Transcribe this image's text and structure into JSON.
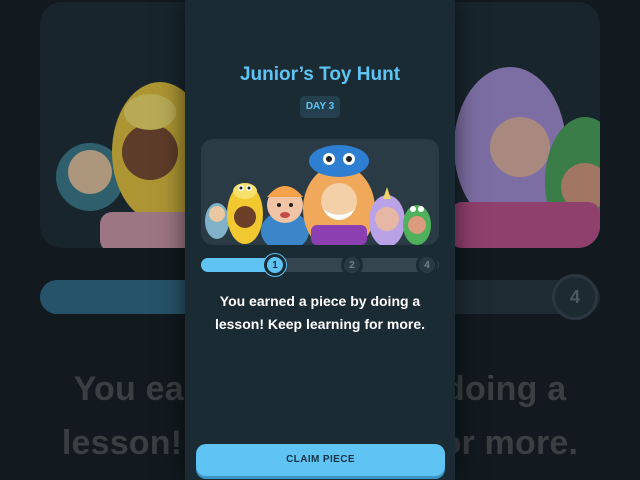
{
  "modal": {
    "title": "Junior’s Toy Hunt",
    "day_badge": "DAY 3",
    "message_line1": "You earned a piece by doing a",
    "message_line2": "lesson! Keep learning for more.",
    "claim_button": "CLAIM PIECE"
  },
  "progress": {
    "fraction": 0.3,
    "steps": [
      {
        "label": "1",
        "state": "active"
      },
      {
        "label": "2",
        "state": "inactive"
      },
      {
        "label": "4",
        "state": "inactive"
      }
    ]
  },
  "background": {
    "step_label": "4",
    "text_line1": "You earned a piece by doing a",
    "text_line2": "lesson! Keep learning for more."
  },
  "colors": {
    "accent": "#5fc3f4",
    "modal_bg": "#1a2b34",
    "title": "#5fc3f4",
    "button_text": "#123345"
  }
}
